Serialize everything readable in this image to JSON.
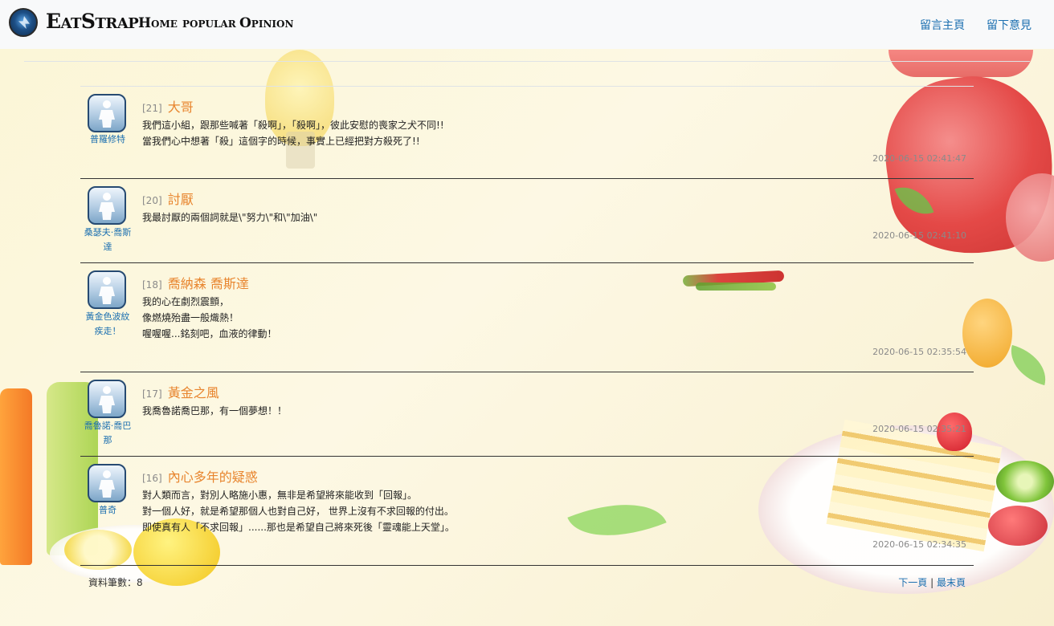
{
  "nav": {
    "brand": "EatStrap",
    "links": [
      "Home",
      "popular",
      "Opinion"
    ],
    "right_links": [
      "留言主頁",
      "留下意見"
    ]
  },
  "posts": [
    {
      "num": "[21]",
      "title": "大哥",
      "author": "普羅修特",
      "body": "我們這小組，跟那些喊著「殺啊」，「殺啊」，彼此安慰的喪家之犬不同!!\n當我們心中想著「殺」這個字的時候，事實上已經把對方殺死了!!",
      "time": "2020-06-15 02:41:47"
    },
    {
      "num": "[20]",
      "title": "討厭",
      "author": "桑瑟夫‧喬斯達",
      "body": "我最討厭的兩個詞就是\\\"努力\\\"和\\\"加油\\\"",
      "time": "2020-06-15 02:41:10"
    },
    {
      "num": "[18]",
      "title": "喬納森 喬斯達",
      "author": "黃金色波紋疾走！",
      "body": "我的心在劇烈震顫，\n像燃燒殆盡一般熾熱！\n喔喔喔...銘刻吧，血液的律動！",
      "time": "2020-06-15 02:35:54"
    },
    {
      "num": "[17]",
      "title": "黃金之風",
      "author": "喬魯諾‧喬巴那",
      "body": "我喬魯諾喬巴那，有一個夢想！！",
      "time": "2020-06-15 02:35:21"
    },
    {
      "num": "[16]",
      "title": "內心多年的疑惑",
      "author": "普奇",
      "body": "對人類而言，對別人略施小惠，無非是希望將來能收到「回報」。\n對一個人好，就是希望那個人也對自己好， 世界上沒有不求回報的付出。\n即使真有人「不求回報」......那也是希望自己將來死後「靈魂能上天堂」。",
      "time": "2020-06-15 02:34:35"
    }
  ],
  "footer": {
    "count_label": "資料筆數：8",
    "next": "下一頁",
    "sep": "|",
    "last": "最末頁"
  },
  "colors": {
    "title_orange": "#e8852e",
    "link_blue": "#1b6fb0",
    "navbar_bg": "#f8f9fa"
  },
  "icons": [
    "brand-logo-icon",
    "user-avatar-icon"
  ]
}
